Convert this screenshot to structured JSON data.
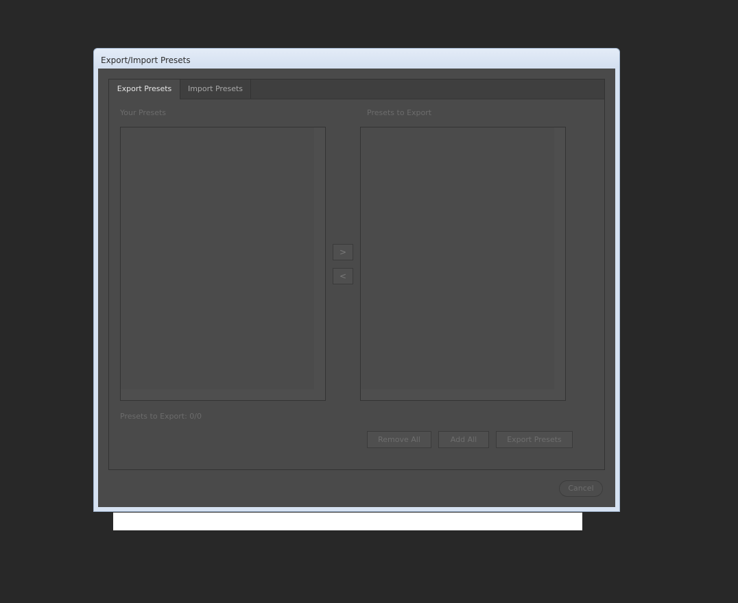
{
  "window": {
    "title": "Export/Import Presets"
  },
  "tabs": [
    {
      "label": "Export Presets",
      "active": true
    },
    {
      "label": "Import Presets",
      "active": false
    }
  ],
  "export_panel": {
    "your_presets_label": "Your Presets",
    "presets_to_export_label": "Presets to Export",
    "move_right_label": ">",
    "move_left_label": "<",
    "count_text": "Presets to Export: 0/0",
    "remove_all_label": "Remove All",
    "add_all_label": "Add All",
    "export_presets_label": "Export Presets"
  },
  "footer": {
    "cancel_label": "Cancel"
  },
  "colors": {
    "desktop_bg": "#282828",
    "window_frame": "#d6e2f2",
    "client_bg": "#4a4a4a",
    "disabled_text": "#6c6c6c"
  }
}
